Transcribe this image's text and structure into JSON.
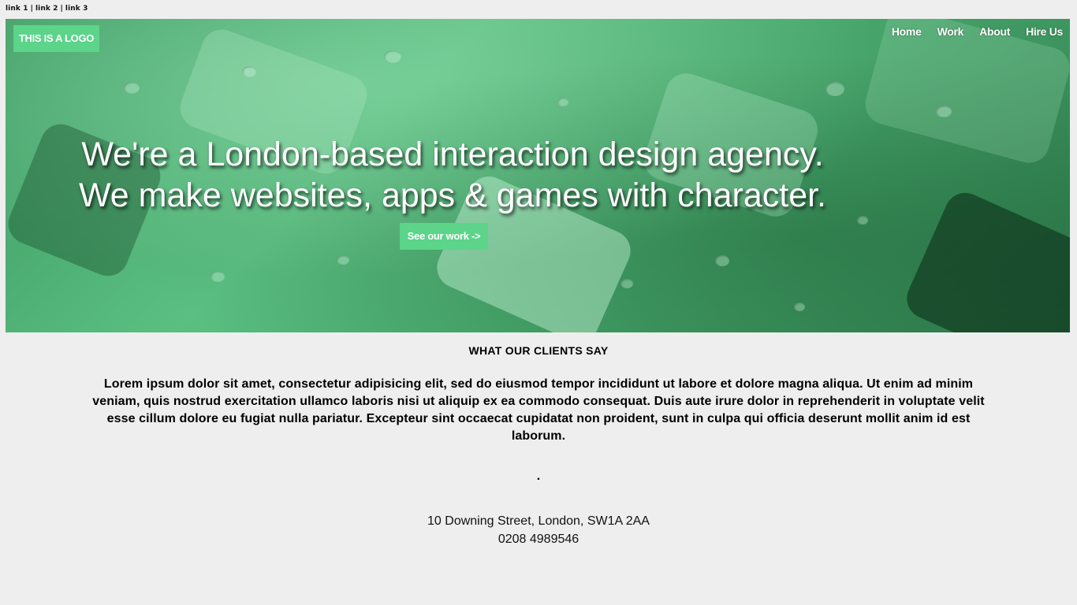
{
  "top_links": [
    "link 1",
    "link 2",
    "link 3"
  ],
  "top_links_separator": "|",
  "logo": "THIS IS A LOGO",
  "nav": [
    "Home",
    "Work",
    "About",
    "Hire Us"
  ],
  "hero": {
    "line1": "We're a London-based interaction design agency.",
    "line2": "We make websites, apps & games with character.",
    "cta": "See our work ->"
  },
  "testimonials": {
    "title": "WHAT OUR CLIENTS SAY",
    "quote": "Lorem ipsum dolor sit amet, consectetur adipisicing elit, sed do eiusmod tempor incididunt ut labore et dolore magna aliqua. Ut enim ad minim veniam, quis nostrud exercitation ullamco laboris nisi ut aliquip ex ea commodo consequat. Duis aute irure dolor in reprehenderit in voluptate velit esse cillum dolore eu fugiat nulla pariatur. Excepteur sint occaecat cupidatat non proident, sunt in culpa qui officia deserunt mollit anim id est laborum.",
    "divider": "."
  },
  "contact": {
    "address": "10 Downing Street, London, SW1A 2AA",
    "phone": "0208 4989546"
  },
  "colors": {
    "accent": "#5cd48a",
    "hero_tint": "#4aa96e",
    "page_bg": "#eeeeee"
  }
}
